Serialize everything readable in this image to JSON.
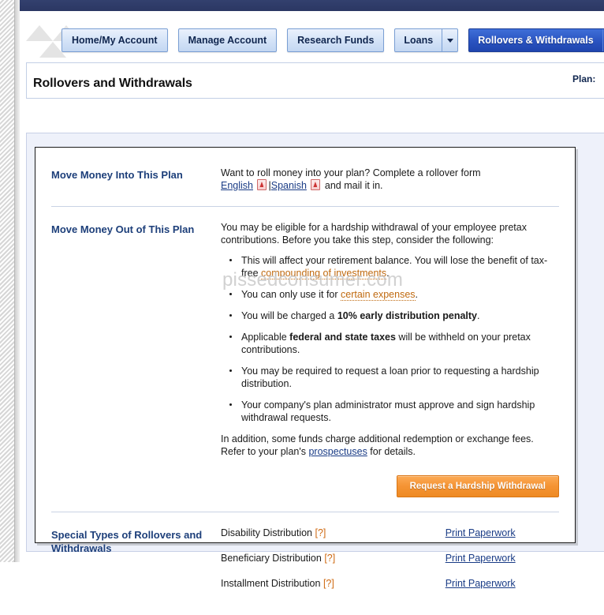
{
  "colors": {
    "topbar": "#2e3a66",
    "nav_active": "#2a53c0",
    "heading_blue": "#1d3f7a",
    "link_blue": "#1a3c86",
    "dotted_link_orange": "#c06a10",
    "cta_orange": "#f59434",
    "help_orange": "#cf6a12",
    "right_box_border": "#c68a14"
  },
  "nav": {
    "tabs": [
      {
        "label": "Home/My Account",
        "active": false,
        "has_dropdown": false
      },
      {
        "label": "Manage Account",
        "active": false,
        "has_dropdown": false
      },
      {
        "label": "Research Funds",
        "active": false,
        "has_dropdown": false
      },
      {
        "label": "Loans",
        "active": false,
        "has_dropdown": true
      },
      {
        "label": "Rollovers & Withdrawals",
        "active": true,
        "has_dropdown": true
      }
    ]
  },
  "header": {
    "page_title": "Rollovers and Withdrawals",
    "plan_label": "Plan:"
  },
  "sections": {
    "move_in": {
      "heading": "Move Money Into This Plan",
      "intro": "Want to roll money into your plan? Complete a rollover form",
      "english_link": "English",
      "separator": "|",
      "spanish_link": "Spanish",
      "tail": " and mail it in."
    },
    "move_out": {
      "heading": "Move Money Out of This Plan",
      "intro": "You may be eligible for a hardship withdrawal of your employee pretax contributions.  Before you take this step, consider the following:",
      "bullets": [
        {
          "pre": "This will affect your retirement balance. You will lose the benefit of tax-free ",
          "link": "compounding of investments",
          "post": "."
        },
        {
          "pre": "You can only use it for ",
          "link": "certain expenses",
          "post": "."
        },
        {
          "pre": "You will be charged a ",
          "bold": "10% early distribution penalty",
          "post": "."
        },
        {
          "pre": "Applicable ",
          "bold": "federal and state taxes",
          "post": " will be withheld on your pretax contributions."
        },
        {
          "pre": "You may be required to request a loan prior to requesting a hardship distribution."
        },
        {
          "pre": "Your company's plan administrator must approve and sign hardship withdrawal requests."
        }
      ],
      "afternote_pre": "In addition, some funds charge additional redemption or exchange fees.  Refer to your plan's ",
      "afternote_link": "prospectuses",
      "afternote_post": " for details.",
      "cta_label": "Request a Hardship Withdrawal"
    },
    "special": {
      "heading": "Special Types of Rollovers and Withdrawals",
      "rows": [
        {
          "name": "Disability Distribution",
          "help": "[?]",
          "action": "Print Paperwork"
        },
        {
          "name": "Beneficiary Distribution",
          "help": "[?]",
          "action": "Print Paperwork"
        },
        {
          "name": "Installment Distribution",
          "help": "[?]",
          "action": "Print Paperwork"
        }
      ]
    }
  },
  "watermark": {
    "text": "pissedconsumer.com"
  }
}
